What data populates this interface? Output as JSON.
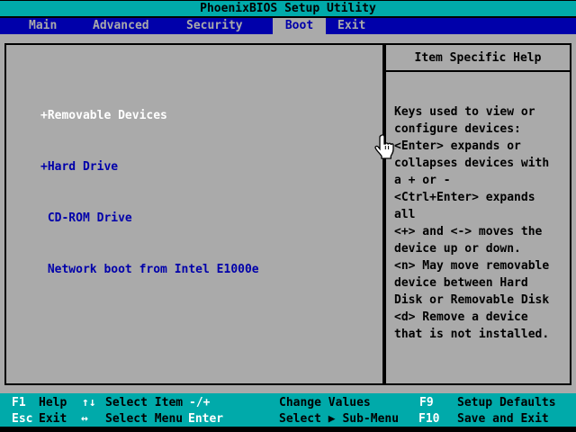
{
  "window": {
    "title": "PhoenixBIOS Setup Utility"
  },
  "colors": {
    "teal": "#00AAAA",
    "menu_blue": "#0000AA",
    "panel_gray": "#AAAAAA",
    "item_blue": "#0000AA",
    "selected_white": "#FFFFFF",
    "black": "#000000"
  },
  "menu": {
    "items": [
      {
        "label": "Main",
        "selected": false
      },
      {
        "label": "Advanced",
        "selected": false
      },
      {
        "label": "Security",
        "selected": false
      },
      {
        "label": "Boot",
        "selected": true
      },
      {
        "label": "Exit",
        "selected": false
      }
    ]
  },
  "boot_list": {
    "items": [
      {
        "text": "+Removable Devices",
        "selected": true
      },
      {
        "text": "+Hard Drive",
        "selected": false
      },
      {
        "text": " CD-ROM Drive",
        "selected": false
      },
      {
        "text": " Network boot from Intel E1000e",
        "selected": false
      }
    ]
  },
  "help_panel": {
    "title": "Item Specific Help",
    "lines": [
      "Keys used to view or",
      "configure devices:",
      "<Enter> expands or",
      "collapses devices with",
      "a + or -",
      "<Ctrl+Enter> expands",
      "all",
      "<+> and <-> moves the",
      "device up or down.",
      "<n> May move removable",
      "device between Hard",
      "Disk or Removable Disk",
      "<d> Remove a device",
      "that is not installed."
    ]
  },
  "footer": {
    "row1": [
      {
        "key": "F1",
        "label": "Help"
      },
      {
        "key": "↑↓",
        "label": "Select Item"
      },
      {
        "key": "-/+",
        "label": "Change Values"
      },
      {
        "key": "F9",
        "label": "Setup Defaults"
      }
    ],
    "row2": [
      {
        "key": "Esc",
        "label": "Exit"
      },
      {
        "key": "↔",
        "label": "Select Menu"
      },
      {
        "key": "Enter",
        "label": "Select ▶ Sub-Menu"
      },
      {
        "key": "F10",
        "label": "Save and Exit"
      }
    ]
  },
  "cursor": {
    "type": "hand-pointer"
  }
}
